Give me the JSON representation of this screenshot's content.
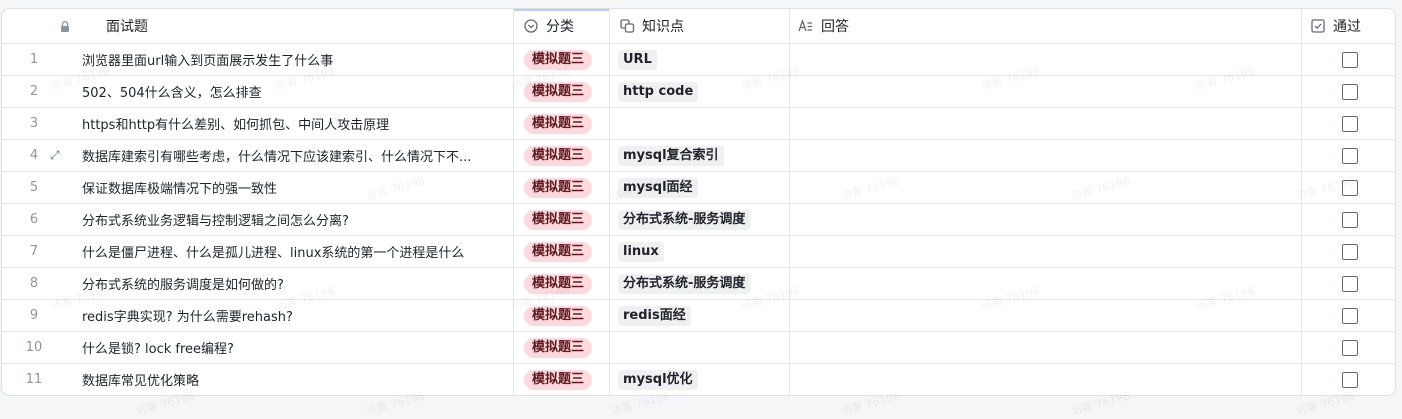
{
  "columns": {
    "question": "面试题",
    "category": "分类",
    "knowledge": "知识点",
    "answer": "回答",
    "passed": "通过"
  },
  "rows": [
    {
      "num": "1",
      "question": "浏览器里面url输入到页面展示发生了什么事",
      "category": "模拟题三",
      "knowledge": "URL",
      "passed": false
    },
    {
      "num": "2",
      "question": "502、504什么含义，怎么排查",
      "category": "模拟题三",
      "knowledge": "http code",
      "passed": false
    },
    {
      "num": "3",
      "question": "https和http有什么差别、如何抓包、中间人攻击原理",
      "category": "模拟题三",
      "knowledge": "",
      "passed": false
    },
    {
      "num": "4",
      "question": "数据库建索引有哪些考虑，什么情况下应该建索引、什么情况下不...",
      "category": "模拟题三",
      "knowledge": "mysql复合索引",
      "passed": false
    },
    {
      "num": "5",
      "question": "保证数据库极端情况下的强一致性",
      "category": "模拟题三",
      "knowledge": "mysql面经",
      "passed": false
    },
    {
      "num": "6",
      "question": "分布式系统业务逻辑与控制逻辑之间怎么分离?",
      "category": "模拟题三",
      "knowledge": "分布式系统-服务调度",
      "passed": false
    },
    {
      "num": "7",
      "question": "什么是僵尸进程、什么是孤儿进程、linux系统的第一个进程是什么",
      "category": "模拟题三",
      "knowledge": "linux",
      "passed": false
    },
    {
      "num": "8",
      "question": "分布式系统的服务调度是如何做的?",
      "category": "模拟题三",
      "knowledge": "分布式系统-服务调度",
      "passed": false
    },
    {
      "num": "9",
      "question": "redis字典实现? 为什么需要rehash?",
      "category": "模拟题三",
      "knowledge": "redis面经",
      "passed": false
    },
    {
      "num": "10",
      "question": "什么是锁? lock free编程?",
      "category": "模拟题三",
      "knowledge": "",
      "passed": false
    },
    {
      "num": "11",
      "question": "数据库常见优化策略",
      "category": "模拟题三",
      "knowledge": "mysql优化",
      "passed": false
    }
  ],
  "watermark": "访客 76196",
  "colors": {
    "category_tag_bg": "#fcd9dc",
    "knowledge_tag_bg": "#eff0f1",
    "border": "#dee0e3"
  }
}
